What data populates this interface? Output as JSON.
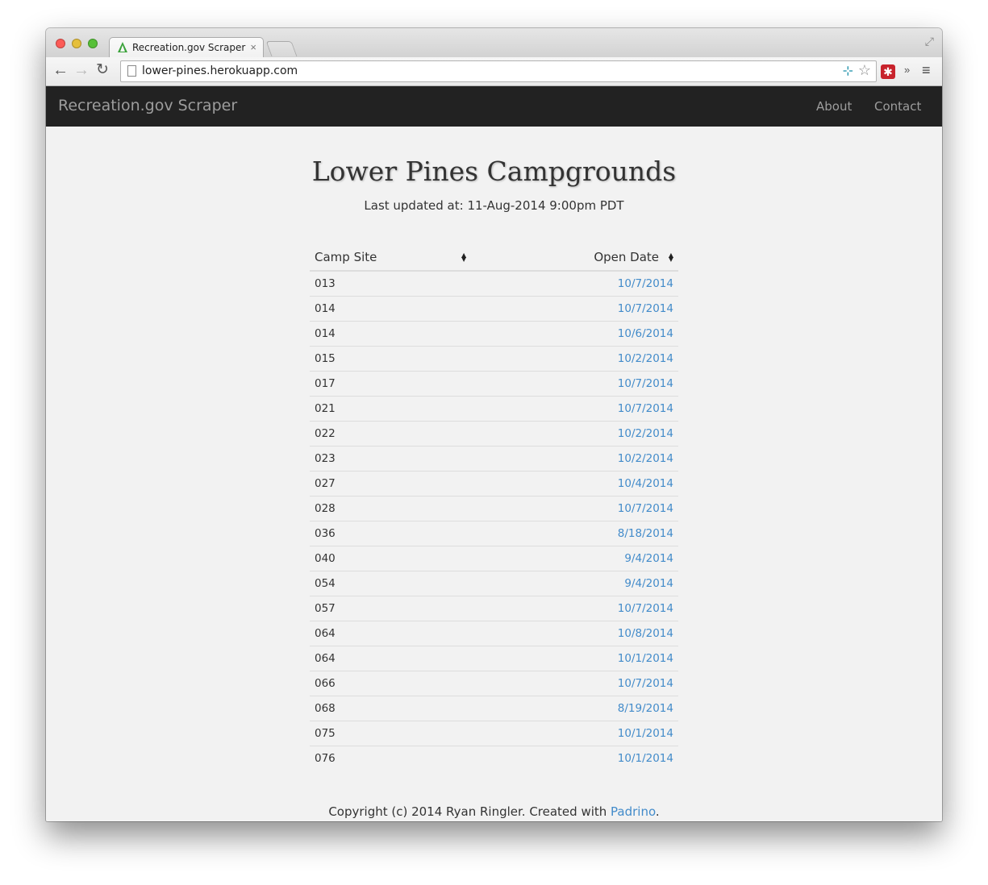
{
  "browser": {
    "tab_title": "Recreation.gov Scraper",
    "tab_close": "×",
    "url": "lower-pines.herokuapp.com",
    "icons": {
      "back": "←",
      "forward": "→",
      "reload": "↻",
      "star": "☆",
      "extension": "⊹",
      "lastpass": "✱",
      "chevron": "»",
      "menu": "≡",
      "fullscreen": "⤢"
    }
  },
  "navbar": {
    "brand": "Recreation.gov Scraper",
    "links": [
      "About",
      "Contact"
    ]
  },
  "main": {
    "title": "Lower Pines Campgrounds",
    "updated": "Last updated at: 11-Aug-2014 9:00pm PDT",
    "table": {
      "headers": [
        "Camp Site",
        "Open Date"
      ],
      "rows": [
        [
          "013",
          "10/7/2014"
        ],
        [
          "014",
          "10/7/2014"
        ],
        [
          "014",
          "10/6/2014"
        ],
        [
          "015",
          "10/2/2014"
        ],
        [
          "017",
          "10/7/2014"
        ],
        [
          "021",
          "10/7/2014"
        ],
        [
          "022",
          "10/2/2014"
        ],
        [
          "023",
          "10/2/2014"
        ],
        [
          "027",
          "10/4/2014"
        ],
        [
          "028",
          "10/7/2014"
        ],
        [
          "036",
          "8/18/2014"
        ],
        [
          "040",
          "9/4/2014"
        ],
        [
          "054",
          "9/4/2014"
        ],
        [
          "057",
          "10/7/2014"
        ],
        [
          "064",
          "10/8/2014"
        ],
        [
          "064",
          "10/1/2014"
        ],
        [
          "066",
          "10/7/2014"
        ],
        [
          "068",
          "8/19/2014"
        ],
        [
          "075",
          "10/1/2014"
        ],
        [
          "076",
          "10/1/2014"
        ]
      ]
    }
  },
  "footer": {
    "prefix": "Copyright (c) 2014 Ryan Ringler. Created with ",
    "link": "Padrino",
    "suffix": "."
  },
  "colors": {
    "navbar_bg": "#222222",
    "link": "#428bca",
    "page_bg": "#f2f2f2"
  }
}
